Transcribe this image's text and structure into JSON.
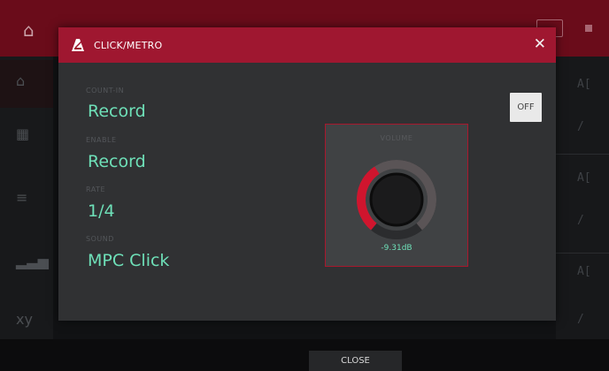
{
  "dialog": {
    "title": "CLICK/METRO",
    "close_symbol": "✕",
    "params": [
      {
        "label": "COUNT-IN",
        "value": "Record"
      },
      {
        "label": "ENABLE",
        "value": "Record"
      },
      {
        "label": "RATE",
        "value": "1/4"
      },
      {
        "label": "SOUND",
        "value": "MPC Click"
      }
    ],
    "toggle_label": "OFF",
    "volume": {
      "label": "VOLUME",
      "value_text": "-9.31dB",
      "level": 0.38
    }
  },
  "footer": {
    "close_label": "CLOSE"
  },
  "background": {
    "right_labels": [
      "A[",
      "A[",
      "A["
    ]
  },
  "icons": {
    "dialog_icon": "metronome-icon",
    "home": "home-icon",
    "edit": "pencil-icon"
  },
  "colors": {
    "header": "#9f1730",
    "accent_red": "#d0152e",
    "value_green": "#6ee0b8",
    "dialog_bg": "#303133"
  }
}
